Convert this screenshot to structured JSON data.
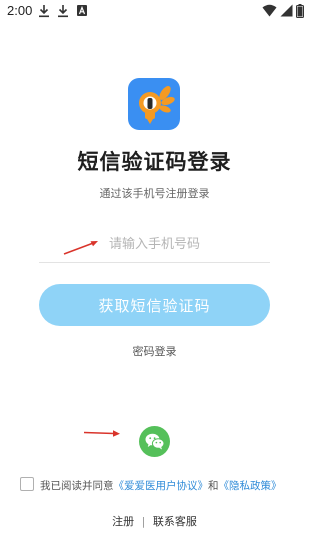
{
  "status_bar": {
    "time": "2:00",
    "left_icons": [
      "download-icon",
      "download-icon",
      "app-notification-icon"
    ],
    "right_icons": [
      "wifi-icon",
      "signal-icon",
      "battery-icon"
    ]
  },
  "app": {
    "icon_name": "app-logo-icon",
    "accent_color": "#3a8ff2"
  },
  "login": {
    "title": "短信验证码登录",
    "subtitle": "通过该手机号注册登录",
    "phone_placeholder": "请输入手机号码",
    "get_code_button": "获取短信验证码",
    "button_color": "#8fd3f7",
    "password_login": "密码登录"
  },
  "third_party": {
    "wechat_icon": "wechat-icon",
    "color": "#55c05a"
  },
  "agreement": {
    "prefix": "我已阅读并同意",
    "user_agreement": "《爱爱医用户协议》",
    "and": "和",
    "privacy_policy": "《隐私政策》"
  },
  "footer": {
    "register": "注册",
    "separator": "|",
    "contact": "联系客服"
  }
}
